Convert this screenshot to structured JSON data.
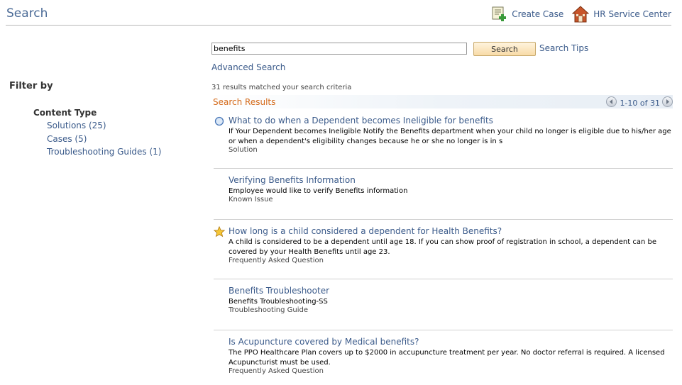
{
  "page": {
    "title": "Search",
    "create_case": "Create Case",
    "hr_service_center": "HR Service Center"
  },
  "filter": {
    "title": "Filter by",
    "content_type_label": "Content Type",
    "facets": [
      "Solutions (25)",
      "Cases (5)",
      "Troubleshooting Guides (1)"
    ]
  },
  "search": {
    "query": "benefits",
    "button_label": "Search",
    "tips_label": "Search Tips",
    "advanced_label": "Advanced Search",
    "match_count": "31 results matched your search criteria"
  },
  "results": {
    "label": "Search Results",
    "pager_text": "1-10 of 31",
    "items": [
      {
        "icon": "circle-icon",
        "title": "What to do when a Dependent becomes Ineligible for benefits",
        "desc": "If Your Dependent becomes Ineligible Notify the Benefits department when your child no longer is eligible due to his/her age or when a dependent's eligibility changes because he or she no longer is in s",
        "type": "Solution"
      },
      {
        "icon": "",
        "title": "Verifying Benefits Information",
        "desc": "Employee would like to verify Benefits information",
        "type": "Known Issue"
      },
      {
        "icon": "star-icon",
        "title": "How long is a child considered a dependent for Health Benefits?",
        "desc": "A child is considered to be a dependent until age 18. If you can show proof of registration in school, a dependent can be covered by your Health Benefits until age 23.",
        "type": "Frequently Asked Question"
      },
      {
        "icon": "",
        "title": "Benefits Troubleshooter",
        "desc": "Benefits Troubleshooting-SS",
        "type": "Troubleshooting Guide"
      },
      {
        "icon": "",
        "title": "Is Acupuncture covered by Medical benefits?",
        "desc": "The PPO Healthcare Plan covers up to $2000 in accupuncture treatment per year. No doctor referral is required. A licensed Acupuncturist must be used.",
        "type": "Frequently Asked Question"
      }
    ]
  }
}
